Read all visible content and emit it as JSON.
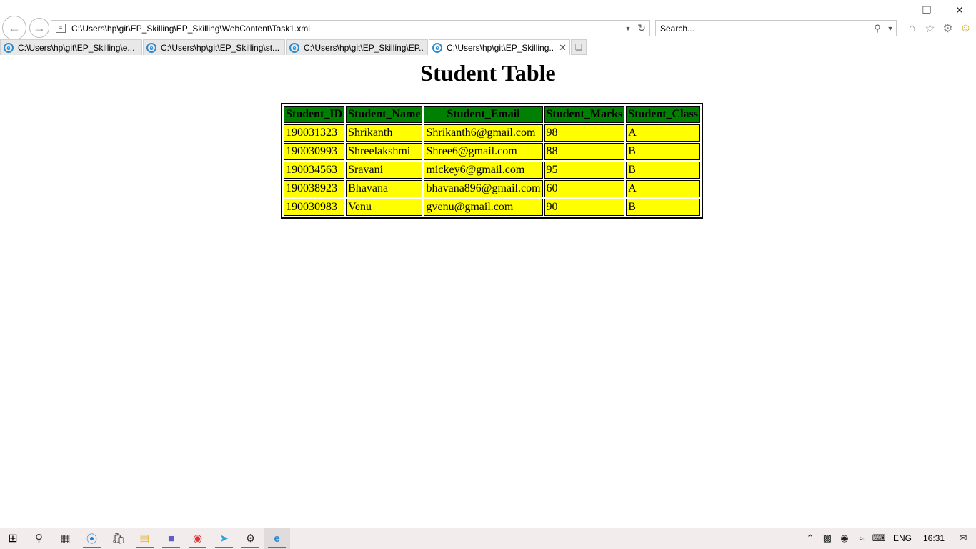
{
  "browser": {
    "address": "C:\\Users\\hp\\git\\EP_Skilling\\EP_Skilling\\WebContent\\Task1.xml",
    "search_placeholder": "Search...",
    "tabs": [
      {
        "label": "C:\\Users\\hp\\git\\EP_Skilling\\e...",
        "active": false
      },
      {
        "label": "C:\\Users\\hp\\git\\EP_Skilling\\st...",
        "active": false
      },
      {
        "label": "C:\\Users\\hp\\git\\EP_Skilling\\EP...",
        "active": false
      },
      {
        "label": "C:\\Users\\hp\\git\\EP_Skilling...",
        "active": true
      }
    ],
    "icons": {
      "back": "back-arrow-icon",
      "forward": "forward-arrow-icon",
      "refresh": "refresh-icon",
      "search": "search-icon",
      "home": "home-icon",
      "favorites": "star-icon",
      "settings": "gear-icon",
      "feedback": "smiley-icon"
    }
  },
  "page": {
    "heading": "Student Table",
    "table": {
      "headers": [
        "Student_ID",
        "Student_Name",
        "Student_Email",
        "Student_Marks",
        "Student_Class"
      ],
      "rows": [
        [
          "190031323",
          "Shrikanth",
          "Shrikanth6@gmail.com",
          "98",
          "A"
        ],
        [
          "190030993",
          "Shreelakshmi",
          "Shree6@gmail.com",
          "88",
          "B"
        ],
        [
          "190034563",
          "Sravani",
          "mickey6@gmail.com",
          "95",
          "B"
        ],
        [
          "190038923",
          "Bhavana",
          "bhavana896@gmail.com",
          "60",
          "A"
        ],
        [
          "190030983",
          "Venu",
          "gvenu@gmail.com",
          "90",
          "B"
        ]
      ]
    },
    "colors": {
      "header_bg": "#008000",
      "cell_bg": "#ffff00"
    }
  },
  "taskbar": {
    "language": "ENG",
    "time": "16:31"
  }
}
